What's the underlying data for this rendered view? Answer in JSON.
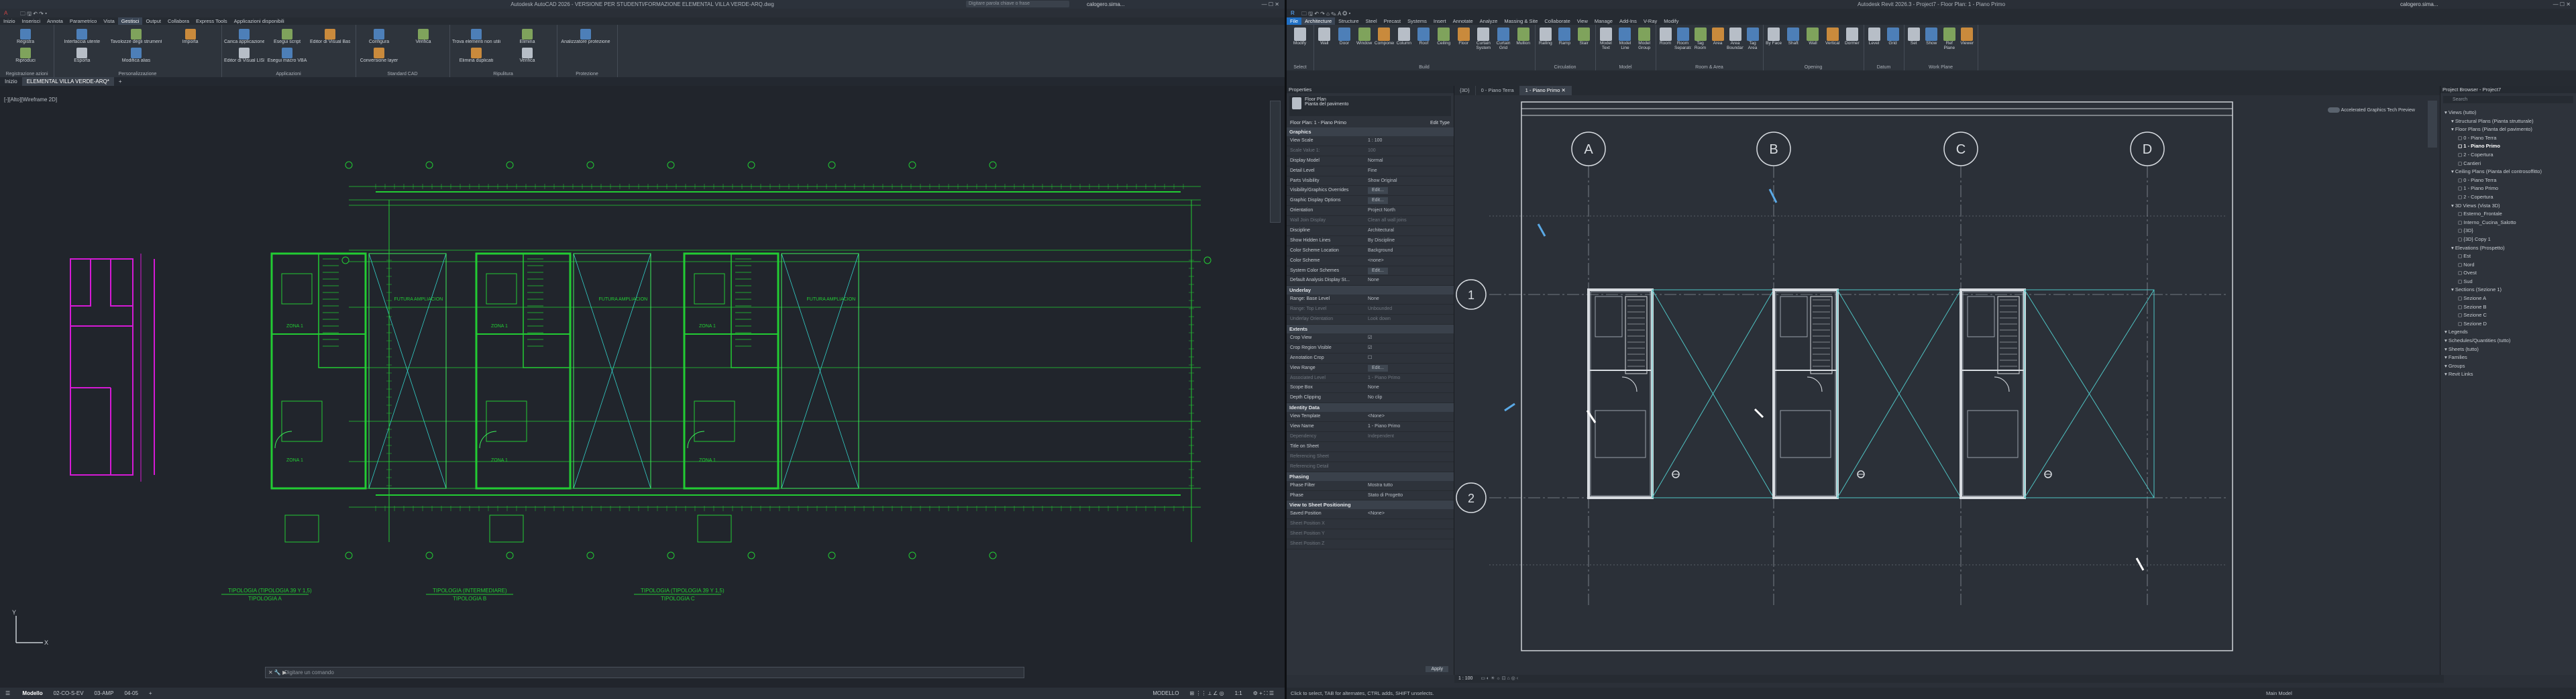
{
  "acad": {
    "title": "Autodesk AutoCAD 2026 - VERSIONE PER STUDENTI/FORMAZIONE  ELEMENTAL VILLA VERDE-ARQ.dwg",
    "search_placeholder": "Digitare parola chiave o frase",
    "user": "calogero.sima...",
    "menu": [
      "Inizio",
      "Inserisci",
      "Annota",
      "Parametrico",
      "Vista",
      "Gestisci",
      "Output",
      "Collabora",
      "Express Tools",
      "Applicazioni disponibili"
    ],
    "active_menu": "Gestisci",
    "ribbon_groups": [
      {
        "label": "Registrazione azioni",
        "buttons": [
          "Registra",
          "Riproduci"
        ]
      },
      {
        "label": "Personalizzazione",
        "buttons": [
          "Interfaccia utente",
          "Tavolozze degli strumenti",
          "Importa",
          "Esporta",
          "Modifica alias"
        ]
      },
      {
        "label": "Applicazioni",
        "buttons": [
          "Carica applicazione",
          "Esegui script",
          "Editor di Visual Basic",
          "Editor di Visual LISP",
          "Esegui macro VBA"
        ]
      },
      {
        "label": "Standard CAD",
        "buttons": [
          "Configura",
          "Verifica",
          "Conversione layer"
        ]
      },
      {
        "label": "Ripulitura",
        "buttons": [
          "Trova elementi non utilizzati",
          "Elimina",
          "Elimina duplicati",
          "Verifica"
        ]
      },
      {
        "label": "Protezione",
        "buttons": [
          "Analizzatore protezione"
        ]
      }
    ],
    "tabs": [
      "Inizio",
      "ELEMENTAL VILLA VERDE-ARQ*"
    ],
    "viewport_label": "[-][Alto][Wireframe 2D]",
    "command_placeholder": "Digitare un comando",
    "layouts": [
      "Modello",
      "02-CO-S-EV",
      "03-AMP",
      "04-05"
    ],
    "status_model": "MODELLO",
    "zoom_scale": "1:1",
    "drawing_labels": {
      "tipo1": "TIPOLOGIA (TIPOLOGIA 39 Y 1,5)",
      "tipo1b": "TIPOLOGIA A",
      "tipo2": "TIPOLOGIA (INTERMEDIARE)",
      "tipo2b": "TIPOLOGIA B",
      "tipo3": "TIPOLOGIA (TIPOLOGIA 39 Y 1,5)",
      "tipo3b": "TIPOLOGIA C",
      "zona": "ZONA 1",
      "futura": "FUTURA AMPLIACION"
    }
  },
  "revit": {
    "title": "Autodesk Revit 2026.3 - Project7 - Floor Plan: 1 - Piano Primo",
    "user": "calogero.sima...",
    "menu": [
      "File",
      "Architecture",
      "Structure",
      "Steel",
      "Precast",
      "Systems",
      "Insert",
      "Annotate",
      "Analyze",
      "Massing & Site",
      "Collaborate",
      "View",
      "Manage",
      "Add-Ins",
      "V-Ray",
      "Modify"
    ],
    "active_menu": "Architecture",
    "ribbon_groups": [
      {
        "label": "Select",
        "buttons": [
          "Modify"
        ]
      },
      {
        "label": "Build",
        "buttons": [
          "Wall",
          "Door",
          "Window",
          "Component",
          "Column",
          "Roof",
          "Ceiling",
          "Floor",
          "Curtain System",
          "Curtain Grid",
          "Mullion"
        ]
      },
      {
        "label": "Circulation",
        "buttons": [
          "Railing",
          "Ramp",
          "Stair"
        ]
      },
      {
        "label": "Model",
        "buttons": [
          "Model Text",
          "Model Line",
          "Model Group"
        ]
      },
      {
        "label": "Room & Area",
        "buttons": [
          "Room",
          "Room Separator",
          "Tag Room",
          "Area",
          "Area Boundary",
          "Tag Area"
        ]
      },
      {
        "label": "Opening",
        "buttons": [
          "By Face",
          "Shaft",
          "Wall",
          "Vertical",
          "Dormer"
        ]
      },
      {
        "label": "Datum",
        "buttons": [
          "Level",
          "Grid"
        ]
      },
      {
        "label": "Work Plane",
        "buttons": [
          "Set",
          "Show",
          "Ref Plane",
          "Viewer"
        ]
      }
    ],
    "properties": {
      "header": "Properties",
      "type_name": "Floor Plan",
      "type_sub": "Pianta del pavimento",
      "selector": "Floor Plan: 1 - Piano Primo",
      "edit_type": "Edit Type",
      "sections": [
        {
          "name": "Graphics",
          "rows": [
            [
              "View Scale",
              "1 : 100",
              false
            ],
            [
              "Scale Value 1:",
              "100",
              true
            ],
            [
              "Display Model",
              "Normal",
              false
            ],
            [
              "Detail Level",
              "Fine",
              false
            ],
            [
              "Parts Visibility",
              "Show Original",
              false
            ],
            [
              "Visibility/Graphics Overrides",
              "Edit...",
              false
            ],
            [
              "Graphic Display Options",
              "Edit...",
              false
            ],
            [
              "Orientation",
              "Project North",
              false
            ],
            [
              "Wall Join Display",
              "Clean all wall joins",
              true
            ],
            [
              "Discipline",
              "Architectural",
              false
            ],
            [
              "Show Hidden Lines",
              "By Discipline",
              false
            ],
            [
              "Color Scheme Location",
              "Background",
              false
            ],
            [
              "Color Scheme",
              "<none>",
              false
            ],
            [
              "System Color Schemes",
              "Edit...",
              false
            ],
            [
              "Default Analysis Display St...",
              "None",
              false
            ]
          ]
        },
        {
          "name": "Underlay",
          "rows": [
            [
              "Range: Base Level",
              "None",
              false
            ],
            [
              "Range: Top Level",
              "Unbounded",
              true
            ],
            [
              "Underlay Orientation",
              "Look down",
              true
            ]
          ]
        },
        {
          "name": "Extents",
          "rows": [
            [
              "Crop View",
              "☑",
              false
            ],
            [
              "Crop Region Visible",
              "☑",
              false
            ],
            [
              "Annotation Crop",
              "☐",
              false
            ],
            [
              "View Range",
              "Edit...",
              false
            ],
            [
              "Associated Level",
              "1 - Piano Primo",
              true
            ],
            [
              "Scope Box",
              "None",
              false
            ],
            [
              "Depth Clipping",
              "No clip",
              false
            ]
          ]
        },
        {
          "name": "Identity Data",
          "rows": [
            [
              "View Template",
              "<None>",
              false
            ],
            [
              "View Name",
              "1 - Piano Primo",
              false
            ],
            [
              "Dependency",
              "Independent",
              true
            ],
            [
              "Title on Sheet",
              "",
              false
            ],
            [
              "Referencing Sheet",
              "",
              true
            ],
            [
              "Referencing Detail",
              "",
              true
            ]
          ]
        },
        {
          "name": "Phasing",
          "rows": [
            [
              "Phase Filter",
              "Mostra tutto",
              false
            ],
            [
              "Phase",
              "Stato di Progetto",
              false
            ]
          ]
        },
        {
          "name": "View to Sheet Positioning",
          "rows": [
            [
              "Saved Position",
              "<None>",
              false
            ],
            [
              "Sheet Position X",
              "",
              true
            ],
            [
              "Sheet Position Y",
              "",
              true
            ],
            [
              "Sheet Position Z",
              "",
              true
            ]
          ]
        }
      ],
      "apply": "Apply"
    },
    "view_tabs": [
      "{3D}",
      "0 - Piano Terra",
      "1 - Piano Primo"
    ],
    "grid_letters": [
      "A",
      "B",
      "C",
      "D"
    ],
    "grid_numbers": [
      "1",
      "2"
    ],
    "graphics_label": "Accelerated Graphics Tech Preview",
    "view_scale": "1 : 100",
    "status": "Click to select, TAB for alternates, CTRL adds, SHIFT unselects.",
    "main_model": "Main Model",
    "browser": {
      "header": "Project Browser - Project7",
      "search": "Search",
      "items": [
        [
          "Views (tutto)",
          0
        ],
        [
          "Structural Plans (Pianta strutturale)",
          1
        ],
        [
          "Floor Plans (Pianta del pavimento)",
          1
        ],
        [
          "0 - Piano Terra",
          2
        ],
        [
          "1 - Piano Primo",
          2
        ],
        [
          "2 - Copertura",
          2
        ],
        [
          "Cantieri",
          2
        ],
        [
          "Ceiling Plans (Pianta del controsoffitto)",
          1
        ],
        [
          "0 - Piano Terra",
          2
        ],
        [
          "1 - Piano Primo",
          2
        ],
        [
          "2 - Copertura",
          2
        ],
        [
          "3D Views (Vista 3D)",
          1
        ],
        [
          "Esterno_Frontale",
          2
        ],
        [
          "Interno_Cucina_Salotto",
          2
        ],
        [
          "{3D}",
          2
        ],
        [
          "{3D} Copy 1",
          2
        ],
        [
          "Elevations (Prospetto)",
          1
        ],
        [
          "Est",
          2
        ],
        [
          "Nord",
          2
        ],
        [
          "Ovest",
          2
        ],
        [
          "Sud",
          2
        ],
        [
          "Sections (Sezione 1)",
          1
        ],
        [
          "Sezione A",
          2
        ],
        [
          "Sezione B",
          2
        ],
        [
          "Sezione C",
          2
        ],
        [
          "Sezione D",
          2
        ],
        [
          "Legends",
          0
        ],
        [
          "Schedules/Quantities (tutto)",
          0
        ],
        [
          "Sheets (tutto)",
          0
        ],
        [
          "Families",
          0
        ],
        [
          "Groups",
          0
        ],
        [
          "Revit Links",
          0
        ]
      ]
    }
  }
}
